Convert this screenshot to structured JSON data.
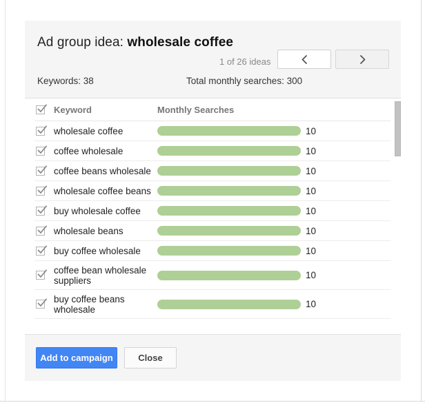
{
  "panel": {
    "title_prefix": "Ad group idea: ",
    "title_name": "wholesale coffee",
    "counter": "1 of 26 ideas",
    "prev_label": "chevron-left",
    "next_label": "chevron-right",
    "stat_keywords": "Keywords: 38",
    "stat_searches": "Total monthly searches: 300"
  },
  "table": {
    "header": {
      "keyword": "Keyword",
      "metric": "Monthly Searches"
    },
    "rows": [
      {
        "keyword": "wholesale coffee",
        "value": "10",
        "checked": true,
        "bar_pct": 100
      },
      {
        "keyword": "coffee wholesale",
        "value": "10",
        "checked": true,
        "bar_pct": 100
      },
      {
        "keyword": "coffee beans wholesale",
        "value": "10",
        "checked": true,
        "bar_pct": 100
      },
      {
        "keyword": "wholesale coffee beans",
        "value": "10",
        "checked": true,
        "bar_pct": 100
      },
      {
        "keyword": "buy wholesale coffee",
        "value": "10",
        "checked": true,
        "bar_pct": 100
      },
      {
        "keyword": "wholesale beans",
        "value": "10",
        "checked": true,
        "bar_pct": 100
      },
      {
        "keyword": "buy coffee wholesale",
        "value": "10",
        "checked": true,
        "bar_pct": 100
      },
      {
        "keyword": "coffee bean wholesale suppliers",
        "value": "10",
        "checked": true,
        "bar_pct": 100
      },
      {
        "keyword": "buy coffee beans wholesale",
        "value": "10",
        "checked": true,
        "bar_pct": 100
      }
    ]
  },
  "footer": {
    "primary_label": "Add to campaign",
    "secondary_label": "Close"
  },
  "colors": {
    "bar_green": "#aecf96",
    "primary_blue": "#4285f4",
    "panel_gray": "#f5f5f5"
  }
}
